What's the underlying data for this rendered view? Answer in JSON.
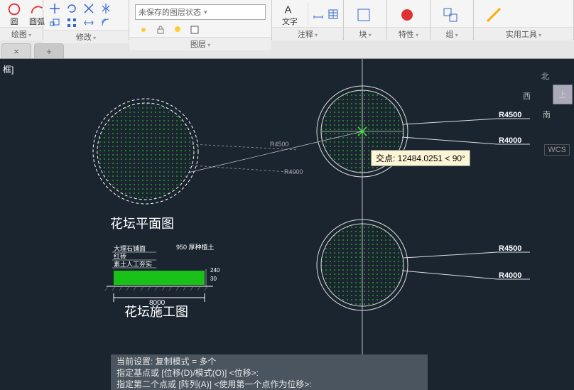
{
  "ribbon": {
    "panels": {
      "draw": {
        "title": "绘图",
        "btn_circle": "圆",
        "btn_arc": "圆弧"
      },
      "modify": {
        "title": "修改"
      },
      "layer": {
        "title": "图层",
        "combo_placeholder": "未保存的图层状态"
      },
      "annot": {
        "title": "注释",
        "btn_text": "文字"
      },
      "block": {
        "title": "块"
      },
      "prop": {
        "title": "特性"
      },
      "group": {
        "title": "组"
      },
      "util": {
        "title": "实用工具"
      }
    }
  },
  "frame_title": "框]",
  "captions": {
    "plan": "花坛平面图",
    "section": "花坛施工图"
  },
  "dims": {
    "R4500": "R4500",
    "R4000": "R4000",
    "d8000": "8000",
    "d240": "240",
    "d30": "30",
    "soil_note": "950 厚种植土",
    "mat1": "大理石铺面",
    "mat2": "红砖",
    "mat3": "素土人工夯实"
  },
  "tooltip": "交点: 12484.0251 < 90°",
  "viewcube": {
    "n": "北",
    "s": "南",
    "w": "西",
    "e": "上"
  },
  "wcs": "WCS",
  "cmd": {
    "l1": "当前设置:   复制模式 = 多个",
    "l2": "指定基点或 [位移(D)/模式(O)] <位移>:",
    "l3": "指定第二个点或 [阵列(A)] <使用第一个点作为位移>:"
  }
}
